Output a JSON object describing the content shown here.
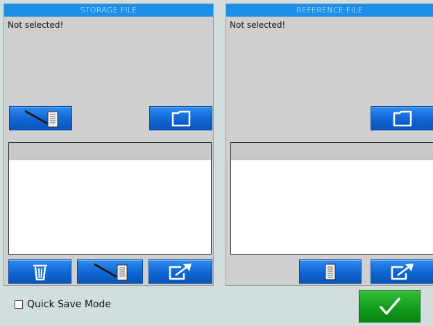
{
  "storage_panel": {
    "title": "STORAGE FILE",
    "status": "Not selected!",
    "buttons": {
      "import": {
        "icon": "pen-document-icon"
      },
      "browse_folder": {
        "icon": "folder-icon"
      },
      "delete": {
        "icon": "trash-icon"
      },
      "import_lower": {
        "icon": "pen-document-icon"
      },
      "export": {
        "icon": "export-arrow-icon"
      }
    }
  },
  "reference_panel": {
    "title": "REFERENCE FILE",
    "status": "Not selected!",
    "buttons": {
      "browse_folder": {
        "icon": "folder-icon"
      },
      "document": {
        "icon": "document-icon"
      },
      "export": {
        "icon": "export-arrow-icon"
      }
    }
  },
  "footer": {
    "quick_save_label": "Quick Save Mode",
    "quick_save_checked": false,
    "ok_icon": "checkmark-icon"
  },
  "colors": {
    "background": "#d2dede",
    "panel": "#cfcfcf",
    "header_blue": "#1e8fe8",
    "button_blue": "#1066d4",
    "ok_green": "#0f9a1a"
  }
}
